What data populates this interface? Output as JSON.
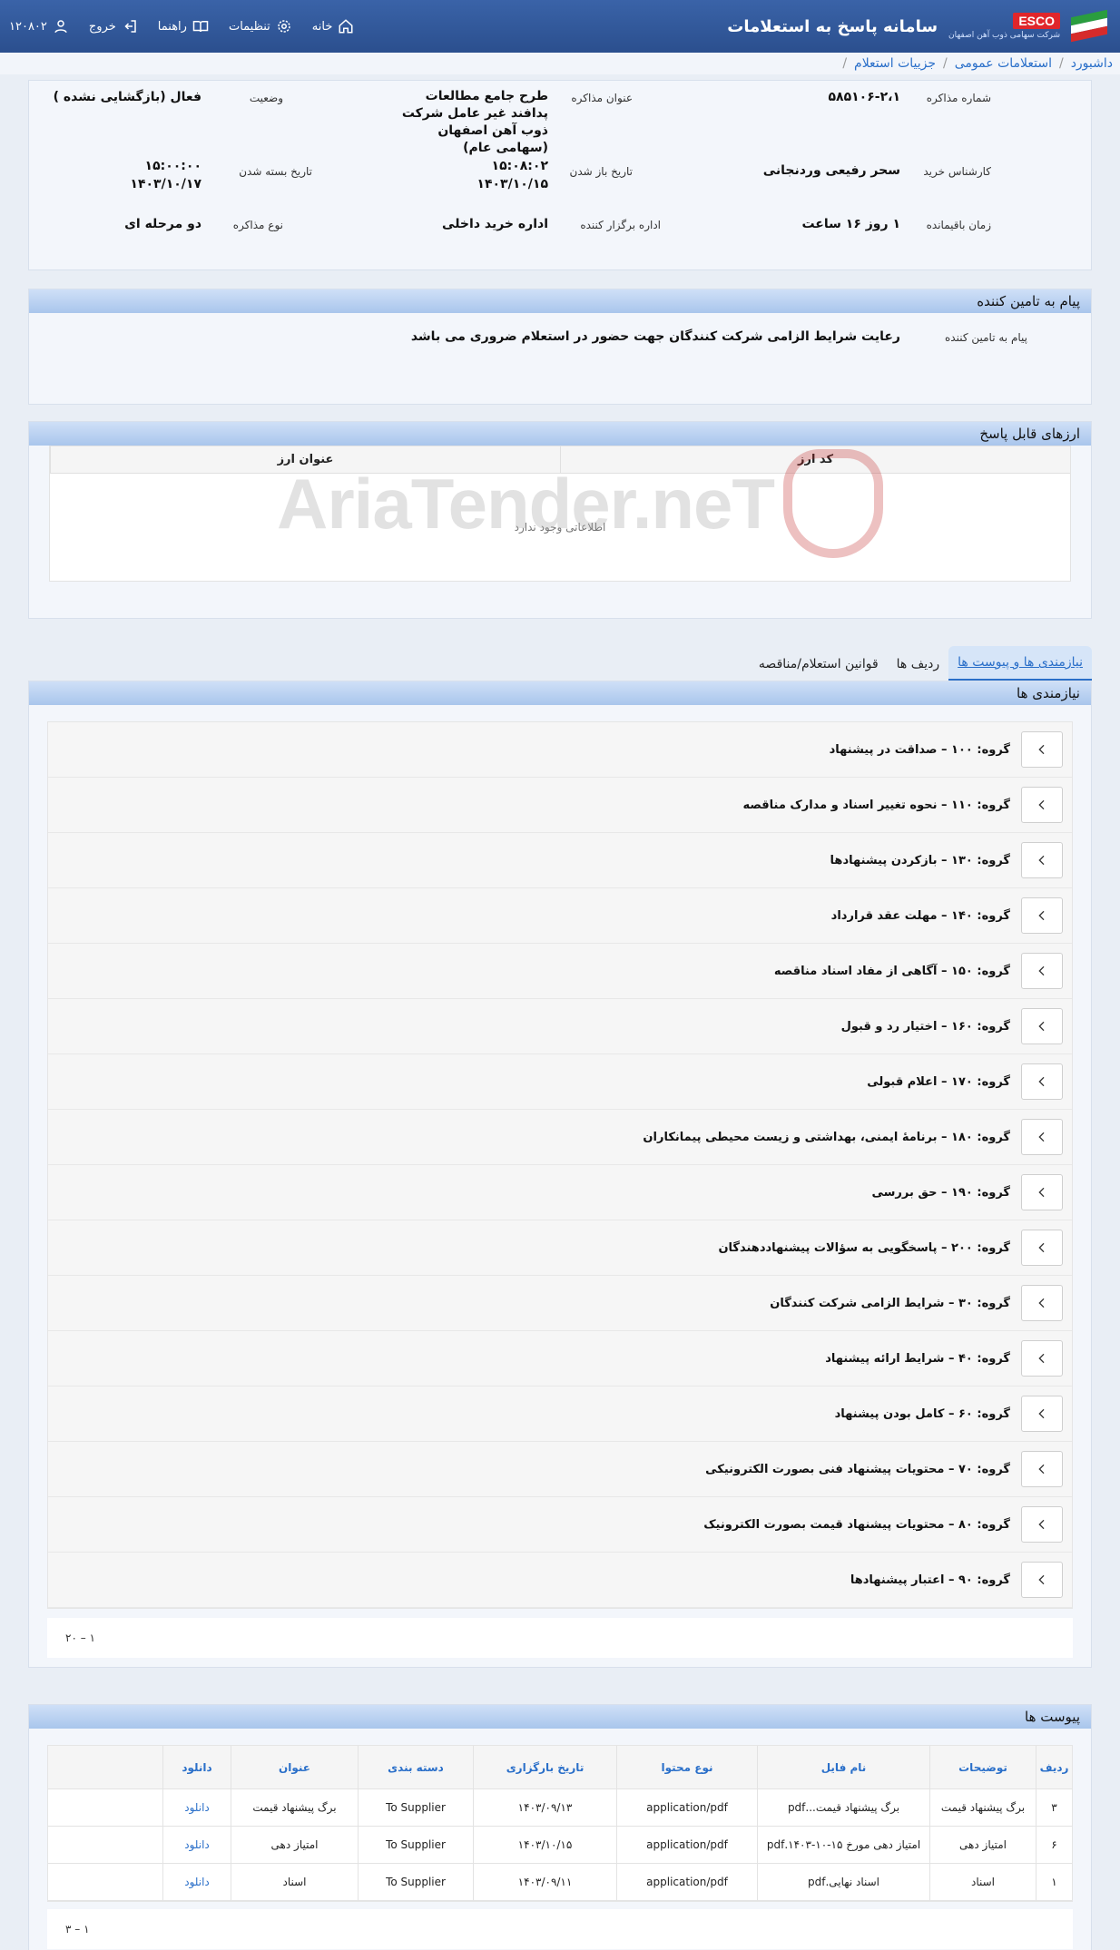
{
  "header": {
    "app_title": "سامانه پاسخ به استعلامات",
    "esco_label": "ESCO",
    "esco_subtitle": "شرکت سهامی ذوب آهن اصفهان",
    "nav": {
      "home": "خانه",
      "settings": "تنظیمات",
      "guides": "راهنما",
      "logout": "خروج",
      "user_code": "۱۲۰۸۰۲"
    }
  },
  "breadcrumb": [
    "داشبورد",
    "استعلامات عمومی",
    "جزییات استعلام"
  ],
  "summary": {
    "number_label": "شماره مذاکره",
    "number_value": "۵۸۵۱۰۶-۲،۱",
    "title_label": "عنوان مذاکره",
    "title_value": "طرح جامع مطالعات پدافند غیر عامل شرکت ذوب آهن اصفهان (سهامی عام)",
    "status_label": "وضعیت",
    "status_value": "فعال (بازگشایی نشده )",
    "expert_label": "کارشناس خرید",
    "expert_value": "سحر رفیعی وردنجانی",
    "open_label": "تاریخ باز شدن",
    "open_time": "۱۵:۰۸:۰۲",
    "open_date": "۱۴۰۳/۱۰/۱۵",
    "close_label": "تاریخ بسته شدن",
    "close_time": "۱۵:۰۰:۰۰",
    "close_date": "۱۴۰۳/۱۰/۱۷",
    "remaining_label": "زمان باقیمانده",
    "remaining_value": "۱ روز ۱۶ ساعت",
    "dept_label": "اداره برگزار کننده",
    "dept_value": "اداره خرید داخلی",
    "type_label": "نوع مذاکره",
    "type_value": "دو مرحله ای"
  },
  "supplier_message": {
    "section_title": "پیام به تامین کننده",
    "label": "پیام به تامین کننده",
    "value": "رعایت شرایط الزامی شرکت کنندگان جهت حضور در استعلام ضروری می باشد"
  },
  "currencies": {
    "section_title": "ارزهای قابل پاسخ",
    "col_code": "کد ارز",
    "col_title": "عنوان ارز",
    "empty_text": "اطلاعاتی وجود ندارد"
  },
  "watermark": "AriaTender.neT",
  "tabs": [
    "نیازمندی ها و پیوست ها",
    "ردیف ها",
    "قوانین استعلام/مناقصه"
  ],
  "requirements": {
    "section_title": "نیازمندی ها",
    "items": [
      "گروه: ۱۰۰ – صداقت در پیشنهاد",
      "گروه: ۱۱۰ – نحوه تغییر اسناد و مدارک مناقصه",
      "گروه: ۱۳۰ – بازکردن پیشنهادها",
      "گروه: ۱۴۰ – مهلت عقد قرارداد",
      "گروه: ۱۵۰ – آگاهی از مفاد اسناد مناقصه",
      "گروه: ۱۶۰ – اختیار رد و قبول",
      "گروه: ۱۷۰ – اعلام قبولی",
      "گروه: ۱۸۰ – برنامهٔ ایمنی، بهداشتی و زیست محیطی پیمانکاران",
      "گروه: ۱۹۰ – حق بررسی",
      "گروه: ۲۰۰ – پاسخگویی به سؤالات پیشنهاددهندگان",
      "گروه: ۳۰ – شرایط الزامی شرکت کنندگان",
      "گروه: ۴۰ – شرایط ارائه پیشنهاد",
      "گروه: ۶۰ – کامل بودن پیشنهاد",
      "گروه: ۷۰ – محتویات پیشنهاد فنی بصورت الکترونیکی",
      "گروه: ۸۰ – محتویات پیشنهاد قیمت بصورت الکترونیک",
      "گروه: ۹۰ – اعتبار پیشنهادها"
    ],
    "pager": "۱ – ۲۰"
  },
  "attachments": {
    "section_title": "پیوست ها",
    "headers": [
      "ردیف",
      "توضیحات",
      "نام فایل",
      "نوع محتوا",
      "تاریخ بارگزاری",
      "دسته بندی",
      "عنوان",
      "دانلود"
    ],
    "rows": [
      [
        "۳",
        "برگ پیشنهاد قیمت",
        "برگ پیشنهاد قیمت...pdf",
        "application/pdf",
        "۱۴۰۳/۰۹/۱۳",
        "To Supplier",
        "برگ پیشنهاد قیمت",
        "دانلود"
      ],
      [
        "۶",
        "امتیاز دهی",
        "امتیاز دهی مورخ ۱۵-۱۰-۱۴۰۳.pdf",
        "application/pdf",
        "۱۴۰۳/۱۰/۱۵",
        "To Supplier",
        "امتیاز دهی",
        "دانلود"
      ],
      [
        "۱",
        "اسناد",
        "اسناد نهایی.pdf",
        "application/pdf",
        "۱۴۰۳/۰۹/۱۱",
        "To Supplier",
        "اسناد",
        "دانلود"
      ]
    ],
    "pager": "۱ – ۳"
  },
  "colors": {
    "header_bg": "#2b4f8e",
    "link": "#2a6fc9",
    "section_head": "#a9c6ec"
  }
}
